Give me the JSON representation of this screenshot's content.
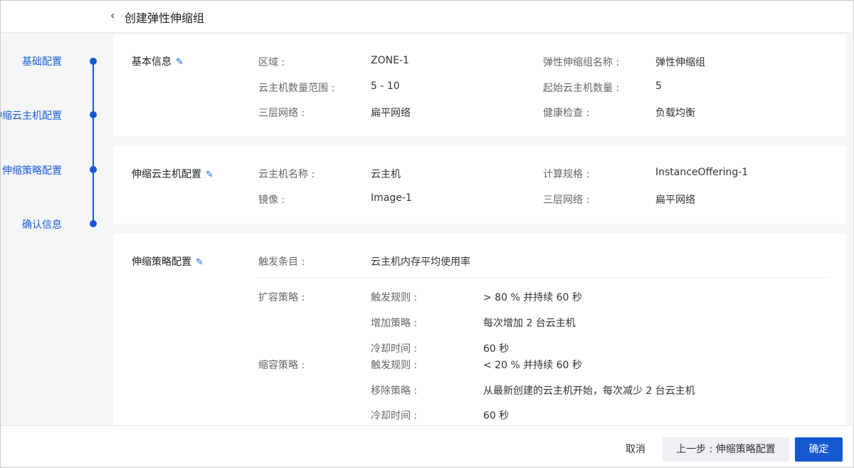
{
  "header": {
    "title": "创建弹性伸缩组"
  },
  "steps": [
    {
      "label": "基础配置"
    },
    {
      "label": "伸缩云主机配置"
    },
    {
      "label": "伸缩策略配置"
    },
    {
      "label": "确认信息"
    }
  ],
  "basic": {
    "title": "基本信息",
    "zone_label": "区域 :",
    "zone_value": "ZONE-1",
    "name_label": "弹性伸缩组名称 :",
    "name_value": "弹性伸缩组",
    "range_label": "云主机数量范围 :",
    "range_value": "5 - 10",
    "init_label": "起始云主机数量 :",
    "init_value": "5",
    "l3_label": "三层网络 :",
    "l3_value": "扁平网络",
    "health_label": "健康检查 :",
    "health_value": "负载均衡"
  },
  "vm": {
    "title": "伸缩云主机配置",
    "vmname_label": "云主机名称 :",
    "vmname_value": "云主机",
    "offering_label": "计算规格 :",
    "offering_value": "InstanceOffering-1",
    "image_label": "镜像 :",
    "image_value": "Image-1",
    "l3_label": "三层网络 :",
    "l3_value": "扁平网络"
  },
  "policy": {
    "title": "伸缩策略配置",
    "trigger_label": "触发条目 :",
    "trigger_value": "云主机内存平均使用率",
    "expand_label": "扩容策略 :",
    "expand_rule_label": "触发规则 :",
    "expand_rule_value": "> 80 % 并持续 60 秒",
    "add_label": "增加策略 :",
    "add_value": "每次增加 2 台云主机",
    "expand_cool_label": "冷却时间 :",
    "expand_cool_value": "60 秒",
    "shrink_label": "缩容策略 :",
    "shrink_rule_label": "触发规则 :",
    "shrink_rule_value": "< 20 % 并持续 60 秒",
    "remove_label": "移除策略 :",
    "remove_value": "从最新创建的云主机开始，每次减少 2 台云主机",
    "shrink_cool_label": "冷却时间 :",
    "shrink_cool_value": "60 秒"
  },
  "footer": {
    "cancel": "取消",
    "prev": "上一步 : 伸缩策略配置",
    "ok": "确定"
  },
  "colors": {
    "accent": "#1559d1",
    "background": "#f5f6f8"
  }
}
